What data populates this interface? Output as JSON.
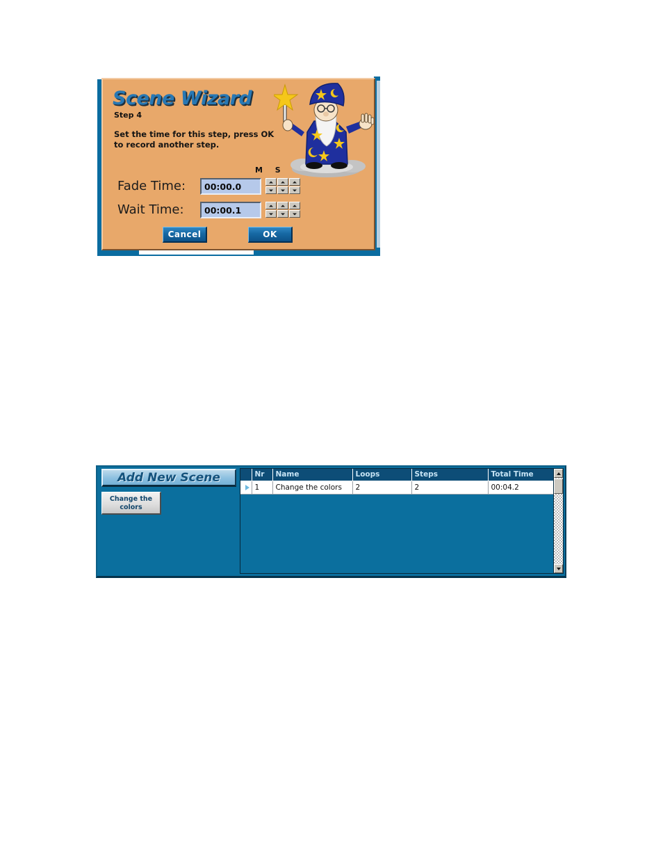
{
  "wizard": {
    "title": "Scene Wizard",
    "step_label": "Step 4",
    "instructions": "Set the time for this step, press OK\nto record another step.",
    "column_letters": "M S",
    "fade": {
      "label": "Fade Time:",
      "value": "00:00.0",
      "spin_up_icon": "triangle-up-icon",
      "spin_down_icon": "triangle-down-icon"
    },
    "wait": {
      "label": "Wait Time:",
      "value": "00:00.1"
    },
    "buttons": {
      "cancel": "Cancel",
      "ok": "OK"
    },
    "mascot_icon": "wizard-mascot-icon",
    "colors": {
      "dialog_background": "#e8a86a",
      "title_blue": "#2878b4",
      "input_background": "#b6c9ea",
      "button_blue": "#1668a3",
      "app_window_blue": "#0a6ca0"
    }
  },
  "scene_panel": {
    "add_new_scene_label": "Add New Scene",
    "change_colors_label": "Change the\ncolors",
    "grid": {
      "columns": [
        "",
        "Nr",
        "Name",
        "Loops",
        "Steps",
        "Total Time"
      ],
      "rows": [
        {
          "marker_icon": "row-selector-arrow-icon",
          "nr": "1",
          "name": "Change the colors",
          "loops": "2",
          "steps": "2",
          "total_time": "00:04.2"
        }
      ]
    },
    "scrollbar": {
      "up_icon": "scroll-up-icon",
      "down_icon": "scroll-down-icon"
    },
    "colors": {
      "panel_background": "#0b6f9e",
      "header_background": "#0d4d77",
      "header_text": "#c7e4f5",
      "add_button_text": "#15537d"
    }
  }
}
